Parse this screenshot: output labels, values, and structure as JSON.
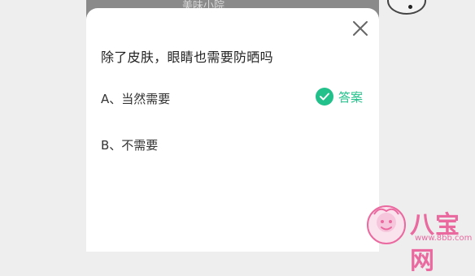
{
  "background": {
    "title": "美味小院"
  },
  "dialog": {
    "question": "除了皮肤，眼睛也需要防晒吗",
    "options": [
      {
        "label": "A、当然需要"
      },
      {
        "label": "B、不需要"
      }
    ],
    "answer_label": "答案"
  },
  "watermark": {
    "text": "八宝网",
    "url": "www.8bb.com"
  },
  "colors": {
    "accent": "#22c08a",
    "watermark": "#ea6aa0"
  },
  "icons": [
    "close-icon",
    "check-circle-icon",
    "watermark-logo-icon"
  ]
}
